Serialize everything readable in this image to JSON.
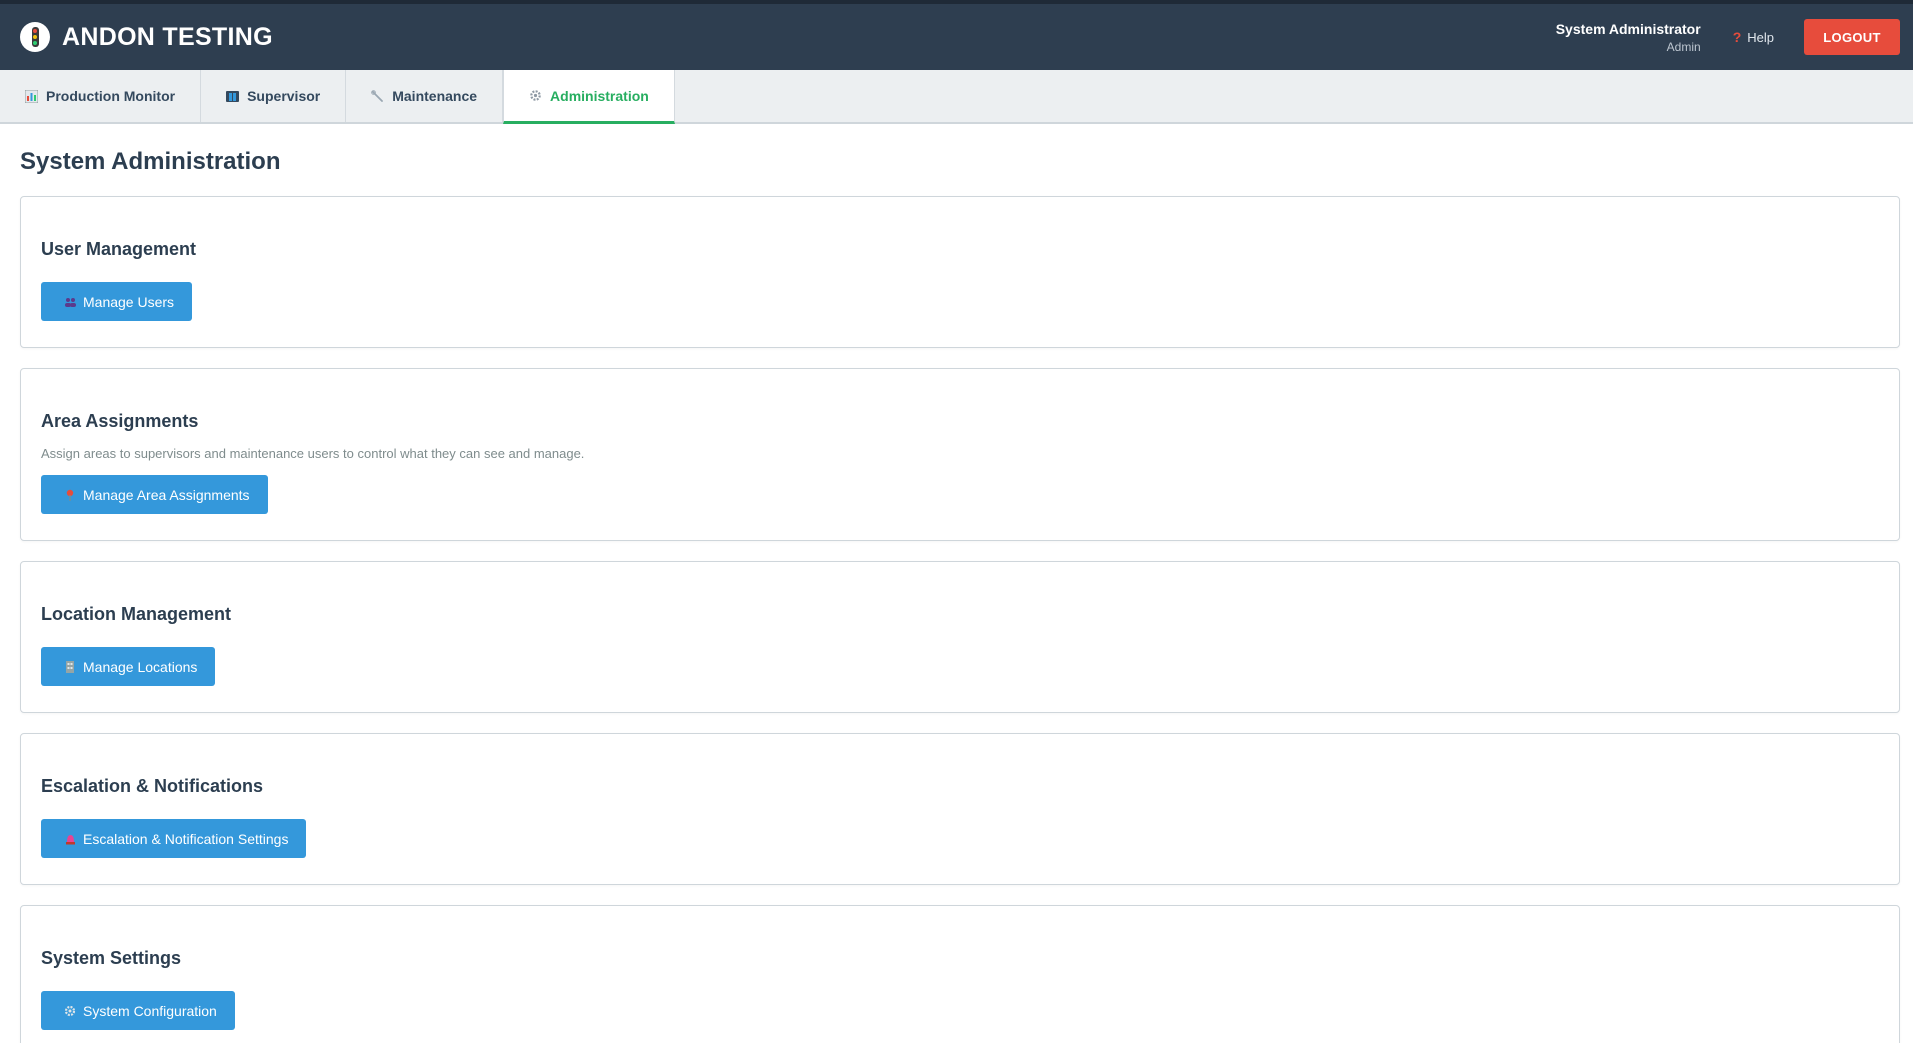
{
  "header": {
    "app_title": "ANDON TESTING",
    "user_name": "System Administrator",
    "user_role": "Admin",
    "help_label": "Help",
    "logout_label": "LOGOUT"
  },
  "tabs": [
    {
      "label": "Production Monitor",
      "icon": "bar-chart-icon"
    },
    {
      "label": "Supervisor",
      "icon": "supervisor-icon"
    },
    {
      "label": "Maintenance",
      "icon": "wrench-icon"
    },
    {
      "label": "Administration",
      "icon": "gear-icon",
      "active": true
    }
  ],
  "page": {
    "title": "System Administration"
  },
  "sections": [
    {
      "title": "User Management",
      "button": "Manage Users",
      "icon": "users-icon"
    },
    {
      "title": "Area Assignments",
      "description": "Assign areas to supervisors and maintenance users to control what they can see and manage.",
      "button": "Manage Area Assignments",
      "icon": "pin-icon"
    },
    {
      "title": "Location Management",
      "button": "Manage Locations",
      "icon": "building-icon"
    },
    {
      "title": "Escalation & Notifications",
      "button": "Escalation & Notification Settings",
      "icon": "alarm-icon"
    },
    {
      "title": "System Settings",
      "button": "System Configuration",
      "icon": "gear-icon"
    }
  ],
  "colors": {
    "header_bg": "#2e3e50",
    "logout_bg": "#e74c3c",
    "active_tab": "#27ae60",
    "primary_button": "#3498db"
  }
}
